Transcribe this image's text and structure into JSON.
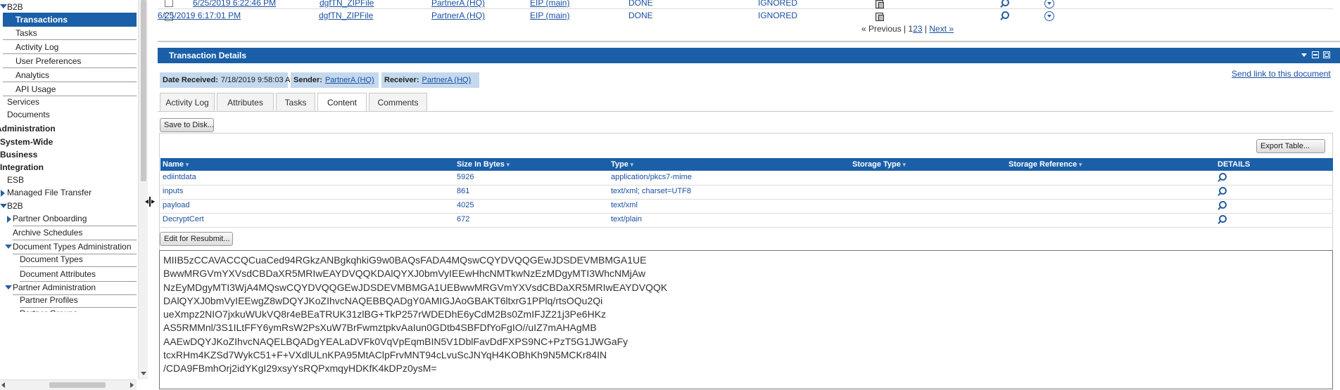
{
  "sidebar": {
    "items": [
      {
        "label": "B2B"
      },
      {
        "label": "Transactions"
      },
      {
        "label": "Tasks"
      },
      {
        "label": "Activity Log"
      },
      {
        "label": "User Preferences"
      },
      {
        "label": "Analytics"
      },
      {
        "label": "API Usage"
      },
      {
        "label": "Services"
      },
      {
        "label": "Documents"
      },
      {
        "label": "Administration"
      },
      {
        "label": "System-Wide"
      },
      {
        "label": "Business"
      },
      {
        "label": "Integration"
      },
      {
        "label": "ESB"
      },
      {
        "label": "Managed File Transfer"
      },
      {
        "label": "B2B"
      },
      {
        "label": "Partner Onboarding"
      },
      {
        "label": "Archive Schedules"
      },
      {
        "label": "Document Types Administration"
      },
      {
        "label": "Document Types"
      },
      {
        "label": "Document Attributes"
      },
      {
        "label": "Partner Administration"
      },
      {
        "label": "Partner Profiles"
      },
      {
        "label": "Partner Groups"
      }
    ]
  },
  "top_list": {
    "rows": [
      {
        "time": "6/25/2019 6:22:46 PM",
        "doc": "dgfTN_ZIPFile",
        "partner": "PartnerA (HQ)",
        "receiver": "EIP (main)",
        "status": "DONE",
        "user_status": "IGNORED"
      },
      {
        "time": "6/25/2019 6:17:01 PM",
        "doc": "dgfTN_ZIPFile",
        "partner": "PartnerA (HQ)",
        "receiver": "EIP (main)",
        "status": "DONE",
        "user_status": "IGNORED"
      }
    ],
    "pager": {
      "previous": "« Previous",
      "separator": "|",
      "pages": [
        "1",
        "2",
        "3"
      ],
      "separator2": "|",
      "next": "Next »"
    }
  },
  "details": {
    "title": "Transaction Details",
    "send_link": "Send link to this document",
    "date_received_label": "Date Received:",
    "date_received_value": "7/18/2019 9:58:03 AM",
    "sender_label": "Sender:",
    "sender_value": "PartnerA (HQ)",
    "receiver_label": "Receiver:",
    "receiver_value": "PartnerA (HQ)",
    "tabs": [
      {
        "label": "Activity Log"
      },
      {
        "label": "Attributes"
      },
      {
        "label": "Tasks"
      },
      {
        "label": "Content"
      },
      {
        "label": "Comments"
      }
    ],
    "active_tab": "Content",
    "save_button": "Save to Disk...",
    "export_button": "Export Table...",
    "resubmit_button": "Edit for Resubmit...",
    "table": {
      "columns": [
        "Name",
        "Size In Bytes",
        "Type",
        "Storage Type",
        "Storage Reference",
        "DETAILS"
      ],
      "rows": [
        {
          "name": "ediintdata",
          "size": "5926",
          "type": "application/pkcs7-mime"
        },
        {
          "name": "inputs",
          "size": "861",
          "type": "text/xml; charset=UTF8"
        },
        {
          "name": "payload",
          "size": "4025",
          "type": "text/xml"
        },
        {
          "name": "DecryptCert",
          "size": "672",
          "type": "text/plain"
        }
      ]
    },
    "content_text": "MIIB5zCCAVACCQCuaCed94RGkzANBgkqhkiG9w0BAQsFADA4MQswCQYDVQQGEwJDSDEVMBMGA1UE\nBwwMRGVmYXVsdCBDaXR5MRIwEAYDVQQKDAlQYXJ0bmVyIEEwHhcNMTkwNzEzMDgyMTI3WhcNMjAw\nNzEyMDgyMTI3WjA4MQswCQYDVQQGEwJDSDEVMBMGA1UEBwwMRGVmYXVsdCBDaXR5MRIwEAYDVQQK\nDAlQYXJ0bmVyIEEwgZ8wDQYJKoZIhvcNAQEBBQADgY0AMIGJAoGBAKT6ltxrG1PPlq/rtsOQu2Qi\nueXmpz2NIO7jxkuWUkVQ8r4eBEaTRUK31zlBG+TkP257rWDEDhE6yCdM2Bs0ZmIFJZ21j3Pe6HKz\nAS5RMMnl/3S1ILtFFY6ymRsW2PsXuW7BrFwmztpkvAaIun0GDtb4SBFDfYoFgIO//uIZ7mAHAgMB\nAAEwDQYJKoZIhvcNAQELBQADgYEALaDVFk0VqVpEqmBIN5V1DblFavDdFXPS9NC+PzT5G1JWGaFy\ntcxRHm4KZSd7WykC51+F+VXdlULnKPA95MtAClpFrvMNT94cLvuScJNYqH4KOBhKh9N5MCKr84IN\n/CDA9FBmhOrj2idYKgI29xsyYsRQPxmqyHDKfK4kDPz0ysM="
  },
  "colors": {
    "header_blue": "#1a5fa8",
    "chip_blue": "#c4d9ee",
    "link_blue": "#1a4fa0"
  }
}
